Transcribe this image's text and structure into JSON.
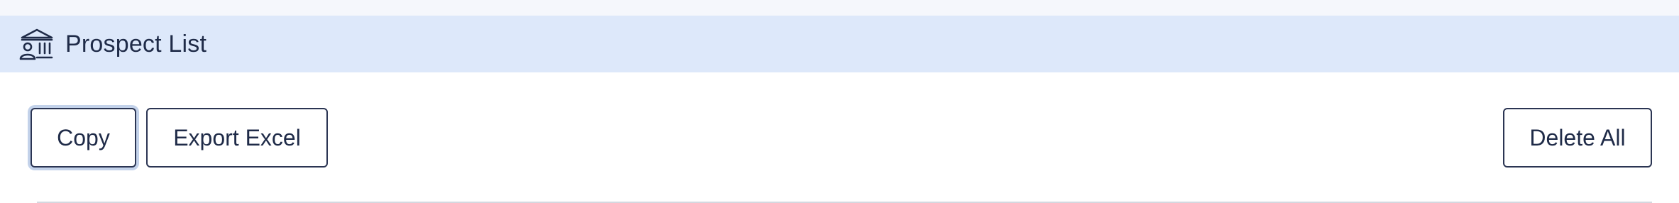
{
  "header": {
    "title": "Prospect List",
    "icon": "bank-user-icon"
  },
  "toolbar": {
    "copy_label": "Copy",
    "export_label": "Export Excel",
    "delete_all_label": "Delete All"
  },
  "colors": {
    "header_background": "#dde8fa",
    "button_border": "#2b3553",
    "text": "#1f2b48",
    "focus_ring": "#c3d2ea"
  }
}
